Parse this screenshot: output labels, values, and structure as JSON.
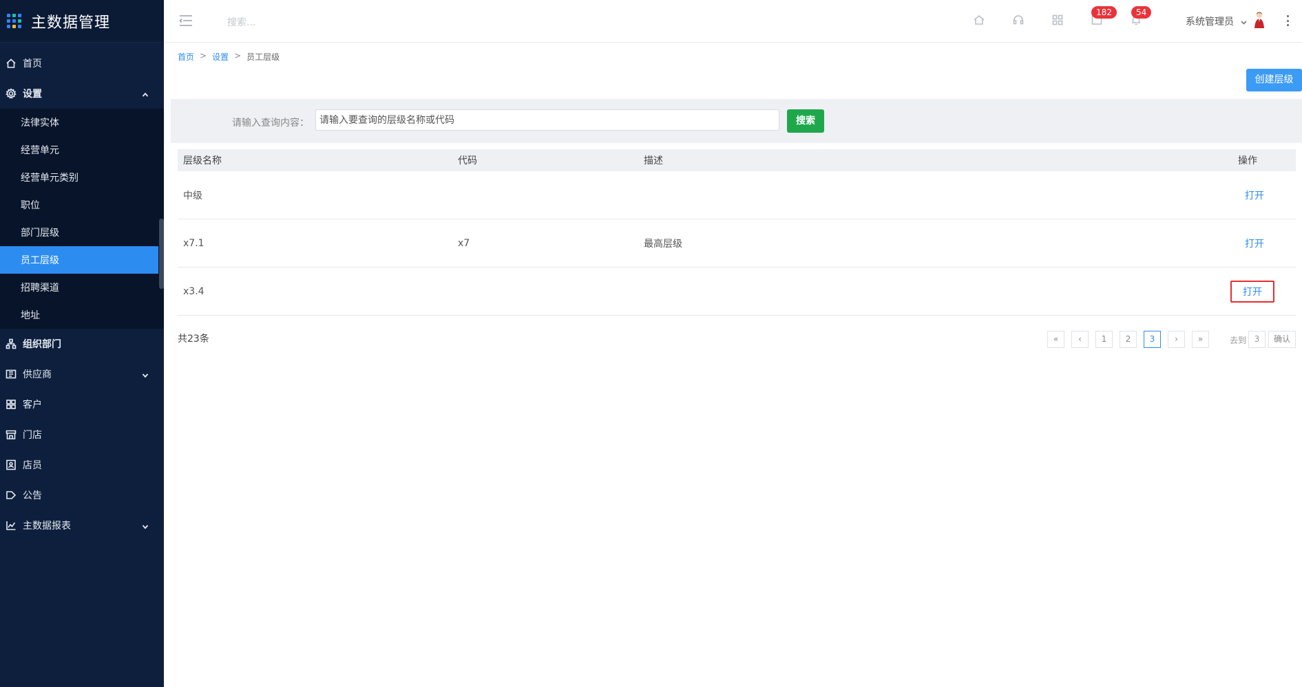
{
  "brand": {
    "title": "主数据管理"
  },
  "sidebar": {
    "items": [
      {
        "label": "首页",
        "icon": "home-icon"
      },
      {
        "label": "设置",
        "icon": "gear-icon",
        "expanded": true
      },
      {
        "label": "组织部门",
        "icon": "org-icon"
      },
      {
        "label": "供应商",
        "icon": "supplier-icon"
      },
      {
        "label": "客户",
        "icon": "customer-icon"
      },
      {
        "label": "门店",
        "icon": "store-icon"
      },
      {
        "label": "店员",
        "icon": "staff-icon"
      },
      {
        "label": "公告",
        "icon": "announcement-icon"
      },
      {
        "label": "主数据报表",
        "icon": "chart-icon"
      }
    ],
    "settings_sub": [
      "法律实体",
      "经营单元",
      "经营单元类别",
      "职位",
      "部门层级",
      "员工层级",
      "招聘渠道",
      "地址"
    ],
    "active_sub": "员工层级"
  },
  "topbar": {
    "search_placeholder": "搜索...",
    "badge_messages": "182",
    "badge_notifications": "54",
    "user_name": "系统管理员"
  },
  "breadcrumb": {
    "home": "首页",
    "settings": "设置",
    "current": "员工层级",
    "sep": ">"
  },
  "toolbar": {
    "create_label": "创建层级"
  },
  "search": {
    "label": "请输入查询内容：",
    "placeholder": "请输入要查询的层级名称或代码",
    "button_label": "搜索"
  },
  "table": {
    "headers": [
      "层级名称",
      "代码",
      "描述",
      "操作"
    ],
    "rows": [
      {
        "name": "中级",
        "code": "",
        "desc": "",
        "action": "打开"
      },
      {
        "name": "x7.1",
        "code": "x7",
        "desc": "最高层级",
        "action": "打开"
      },
      {
        "name": "x3.4",
        "code": "",
        "desc": "",
        "action": "打开"
      }
    ]
  },
  "pagination": {
    "total": "共23条",
    "first": "«",
    "prev": "‹",
    "pages": [
      "1",
      "2",
      "3"
    ],
    "current": "3",
    "next": "›",
    "last": "»",
    "goto_label": "去到",
    "goto_value": "3",
    "confirm": "确认"
  },
  "colors": {
    "sidebar_bg": "#0d1f3c",
    "accent": "#2d8cf0",
    "search_btn": "#1fa84b",
    "badge": "#e9333a"
  }
}
